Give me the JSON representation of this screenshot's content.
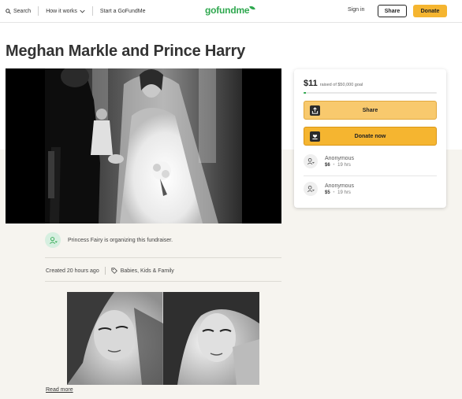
{
  "header": {
    "search_label": "Search",
    "how_it_works_label": "How it works",
    "start_label": "Start a GoFundMe",
    "logo_text": "gofundme",
    "signin_label": "Sign in",
    "share_label": "Share",
    "donate_label": "Donate"
  },
  "campaign": {
    "title": "Meghan Markle and Prince Harry",
    "organizer_text": "Princess Fairy is organizing this fundraiser.",
    "created_text": "Created 20 hours ago",
    "category": "Babies, Kids & Family",
    "read_more_label": "Read more"
  },
  "donation_card": {
    "raised": "$11",
    "goal_text": "raised of $50,000 goal",
    "progress_fraction": 0.00022,
    "share_button_label": "Share",
    "donate_button_label": "Donate now",
    "donors": [
      {
        "name": "Anonymous",
        "amount": "$6",
        "time": "19 hrs"
      },
      {
        "name": "Anonymous",
        "amount": "$5",
        "time": "19 hrs"
      }
    ]
  },
  "colors": {
    "brand_green": "#2fa84f",
    "donate_orange": "#f5b530",
    "beige_bg": "#f6f4ef"
  },
  "icons": [
    "search-icon",
    "chevron-down-icon",
    "share-icon",
    "donate-icon",
    "user-heart-icon",
    "tag-icon"
  ]
}
